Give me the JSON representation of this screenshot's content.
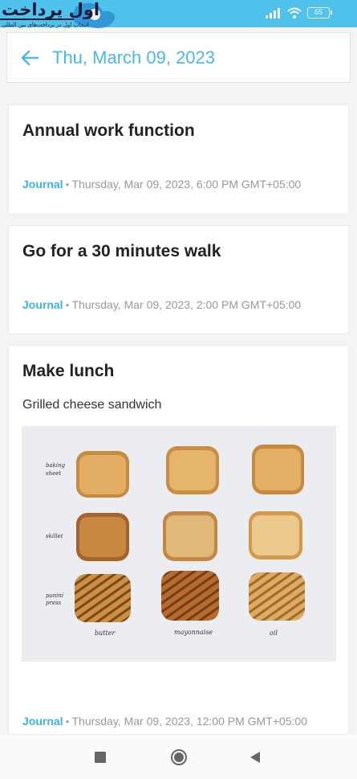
{
  "watermark": {
    "brand": "اول پرداخت",
    "tagline": "انتخاب اول در پرداخت‌های بین المللی"
  },
  "status_bar": {
    "battery": "65",
    "icons": [
      "signal-icon",
      "wifi-icon",
      "battery-icon"
    ]
  },
  "header": {
    "back_icon": "arrow-left-icon",
    "title": "Thu, March 09, 2023"
  },
  "entries": [
    {
      "title": "Annual work function",
      "tag": "Journal",
      "separator": "•",
      "datetime": "Thursday, Mar 09, 2023, 6:00 PM GMT+05:00"
    },
    {
      "title": "Go for a 30 minutes walk",
      "tag": "Journal",
      "separator": "•",
      "datetime": "Thursday, Mar 09, 2023, 2:00 PM GMT+05:00"
    },
    {
      "title": "Make lunch",
      "description": "Grilled cheese sandwich",
      "tag": "Journal",
      "separator": "•",
      "datetime": "Thursday, Mar 09, 2023, 12:00 PM GMT+05:00",
      "image": {
        "row_labels": [
          "baking sheet",
          "skillet",
          "panini press"
        ],
        "column_labels": [
          "butter",
          "mayonnaise",
          "oil"
        ]
      }
    }
  ],
  "nav_bar": {
    "icons": [
      "recents-square-icon",
      "home-circle-icon",
      "back-triangle-icon"
    ]
  },
  "colors": {
    "status_bar": "#4fc3ec",
    "accent": "#4ab8e6",
    "tag": "#3cb2e4"
  }
}
